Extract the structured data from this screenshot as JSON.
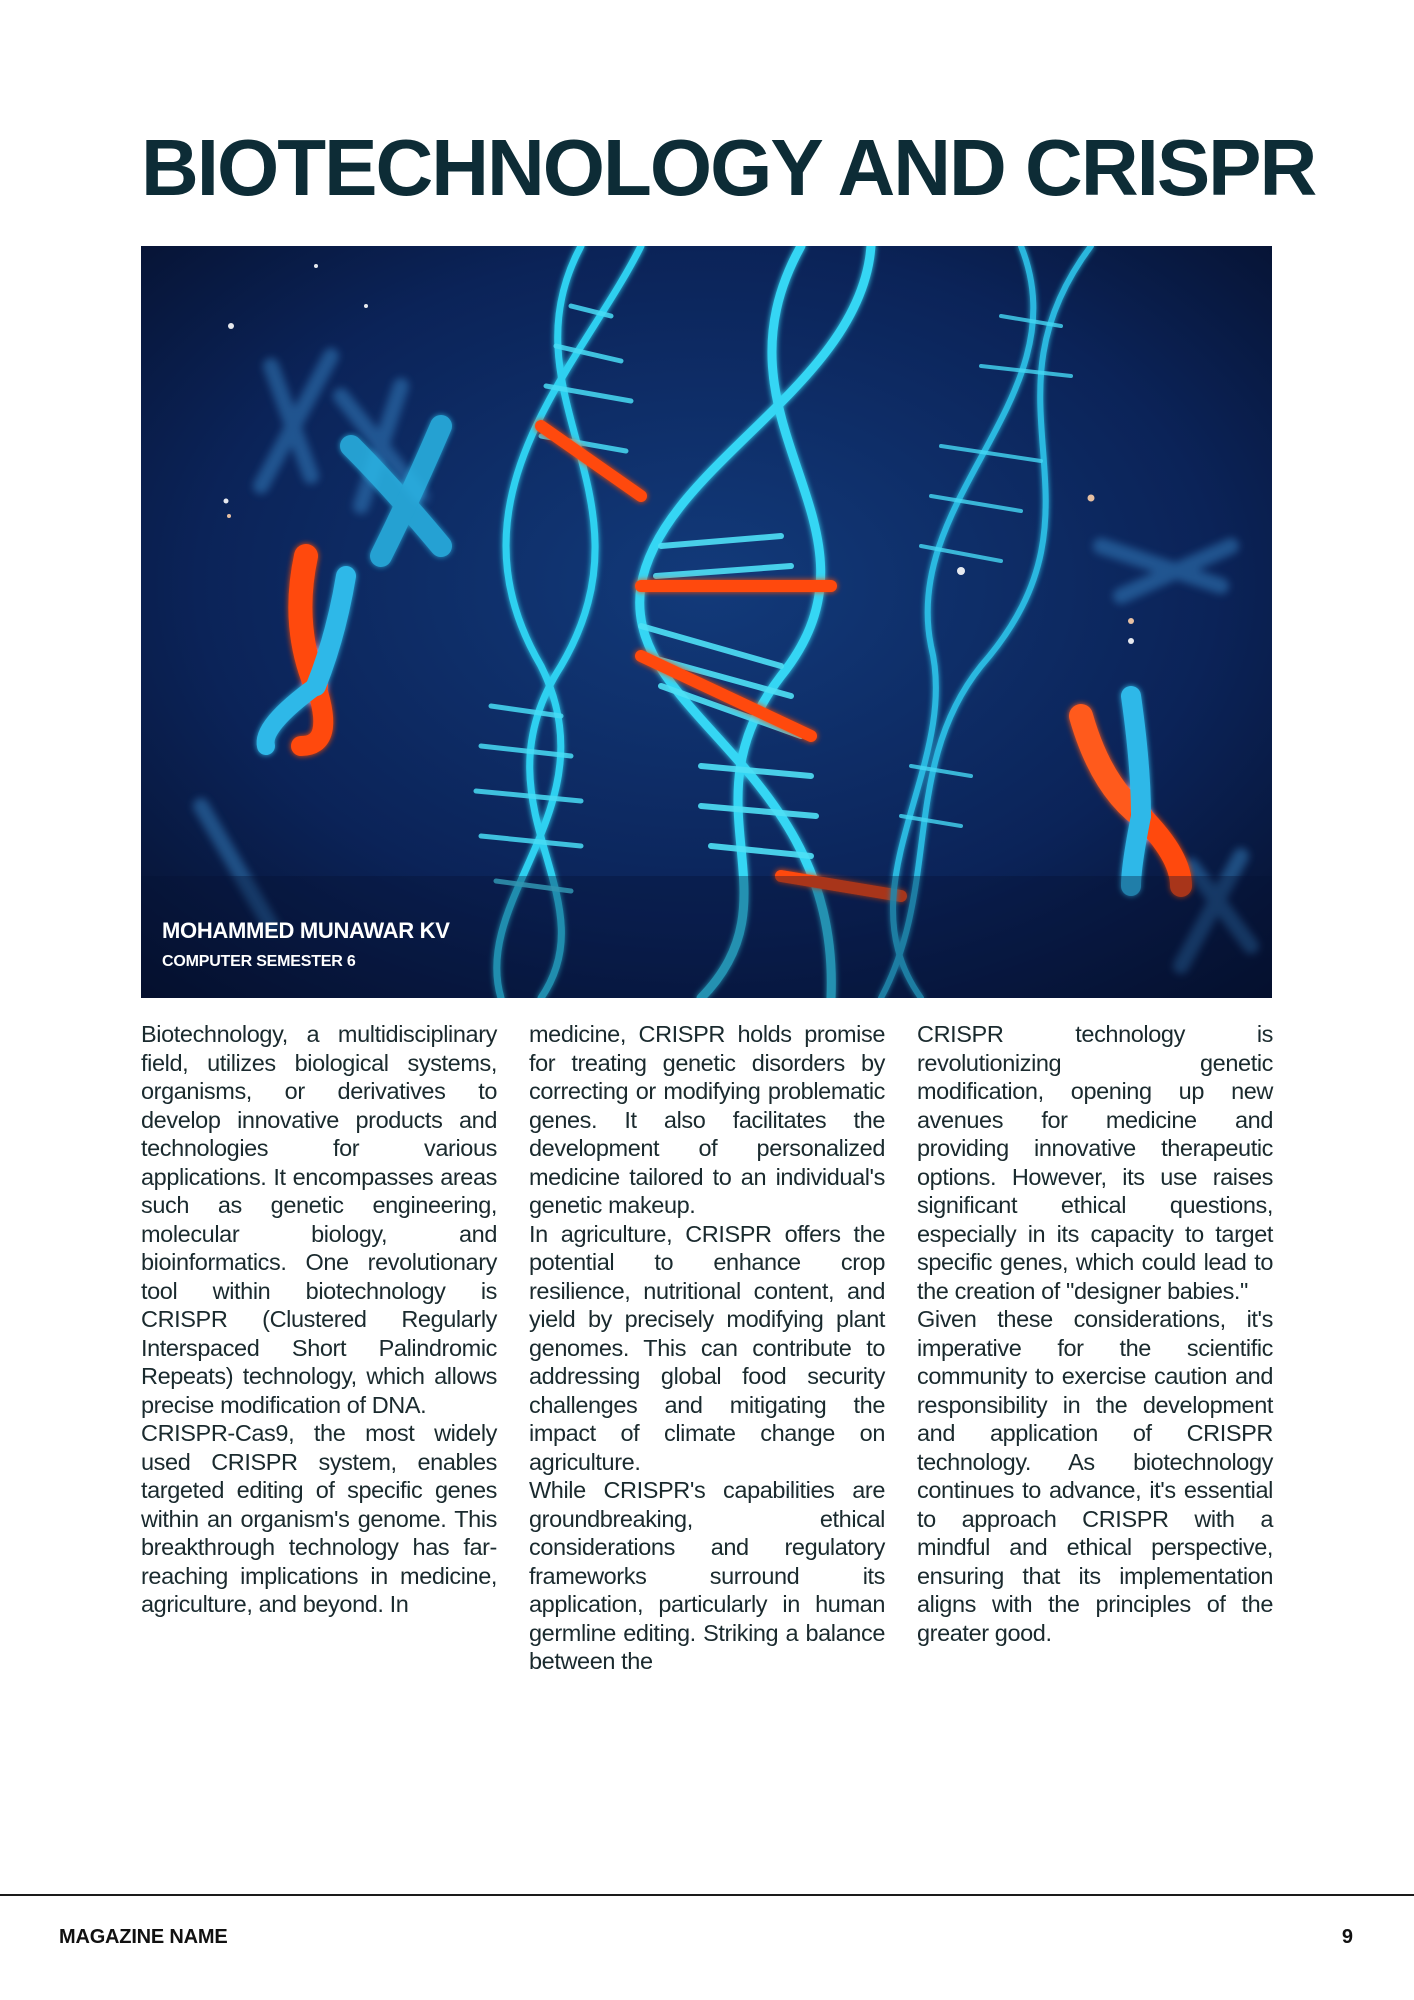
{
  "article": {
    "title": "BIOTECHNOLOGY AND CRISPR",
    "author": "MOHAMMED MUNAWAR KV",
    "course": "COMPUTER SEMESTER 6"
  },
  "image": {
    "subject": "dna-helix-illustration"
  },
  "columns": [
    {
      "paragraphs": [
        "Biotechnology, a multidisciplinary field, utilizes biological systems, organisms, or derivatives to develop innovative products and technologies for various applications. It encompasses areas such as genetic engineering, molecular biology, and bioinformatics. One revolutionary tool within biotechnology is CRISPR (Clustered Regularly Interspaced Short Palindromic Repeats) technology, which allows precise modification of DNA.",
        "CRISPR-Cas9, the most widely used CRISPR system, enables targeted editing of specific genes within an organism's genome. This breakthrough technology has far-reaching implications in medicine, agriculture, and beyond. In"
      ]
    },
    {
      "paragraphs": [
        "medicine, CRISPR holds promise for treating genetic disorders by correcting or modifying problematic genes. It also facilitates the development of personalized medicine tailored to an individual's genetic makeup.",
        "In agriculture, CRISPR offers the potential to enhance crop resilience, nutritional content, and yield by precisely modifying plant genomes. This can contribute to addressing global food security challenges and mitigating the impact of climate change on agriculture.",
        "While CRISPR's capabilities are groundbreaking, ethical considerations and regulatory frameworks surround its application, particularly in human germline editing. Striking a balance between the"
      ]
    },
    {
      "paragraphs": [
        "CRISPR technology is revolutionizing genetic modification, opening up new avenues for medicine and providing innovative therapeutic options. However, its use raises significant ethical questions, especially in its capacity to target specific genes, which could lead to the creation of \"designer babies.\"",
        "Given these considerations, it's imperative for the scientific community to exercise caution and responsibility in the development and application of CRISPR technology. As biotechnology continues to advance, it's essential to approach CRISPR with a mindful and ethical perspective, ensuring that its implementation aligns with the principles of the greater good."
      ]
    }
  ],
  "footer": {
    "magazine_name": "MAGAZINE NAME",
    "page_number": "9"
  },
  "colors": {
    "title": "#0d2c36",
    "helix": "#2fd0f0",
    "accent": "#ff4a10",
    "background": "#0a1f4d"
  }
}
